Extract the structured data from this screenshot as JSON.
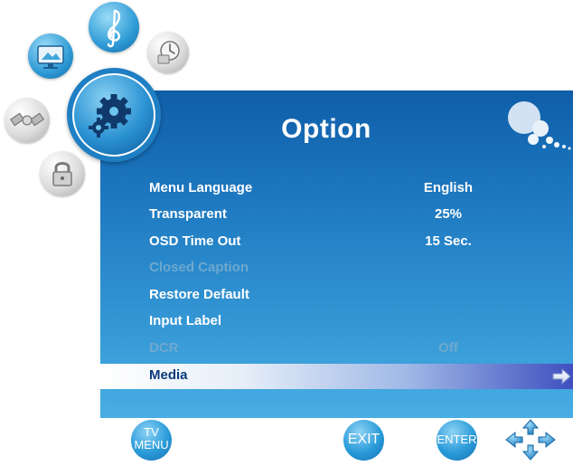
{
  "panel": {
    "title": "Option"
  },
  "menu": {
    "items": [
      {
        "label": "Menu Language",
        "value": "English",
        "enabled": true,
        "selected": false
      },
      {
        "label": "Transparent",
        "value": "25%",
        "enabled": true,
        "selected": false
      },
      {
        "label": "OSD Time Out",
        "value": "15 Sec.",
        "enabled": true,
        "selected": false
      },
      {
        "label": "Closed Caption",
        "value": "",
        "enabled": false,
        "selected": false
      },
      {
        "label": "Restore Default",
        "value": "",
        "enabled": true,
        "selected": false
      },
      {
        "label": "Input Label",
        "value": "",
        "enabled": true,
        "selected": false
      },
      {
        "label": "DCR",
        "value": "Off",
        "enabled": false,
        "selected": false
      },
      {
        "label": "Media",
        "value": "",
        "enabled": true,
        "selected": true
      }
    ]
  },
  "side_icons": [
    {
      "name": "music-icon"
    },
    {
      "name": "picture-icon"
    },
    {
      "name": "clock-icon"
    },
    {
      "name": "settings-gears-icon"
    },
    {
      "name": "satellite-icon"
    },
    {
      "name": "lock-icon"
    }
  ],
  "footer": {
    "tv_menu_line1": "TV",
    "tv_menu_line2": "MENU",
    "exit_label": "EXIT",
    "enter_label": "ENTER"
  },
  "colors": {
    "panel_top": "#0f5ea8",
    "panel_bottom": "#48aee3",
    "selection_end": "#3f4fbf",
    "disabled_text": "#6ea8cf"
  }
}
